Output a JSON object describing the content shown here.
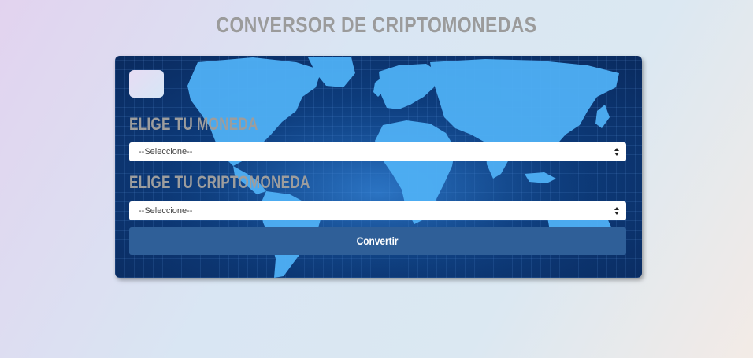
{
  "header": {
    "title": "CONVERSOR DE CRIPTOMONEDAS"
  },
  "form": {
    "currency_label": "ELIGE TU MONEDA",
    "currency_select_value": "--Seleccione--",
    "crypto_label": "ELIGE TU CRIPTOMONEDA",
    "crypto_select_value": "--Seleccione--",
    "submit_label": "Convertir"
  },
  "colors": {
    "title": "#9b9b9b",
    "button": "#2f5f98",
    "card_background": "#0d3c7c",
    "map_land": "#4fb0f5"
  }
}
